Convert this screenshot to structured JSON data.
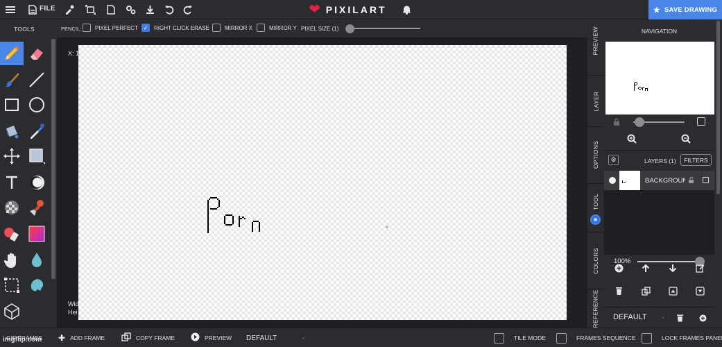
{
  "topbar": {
    "file_label": "FILE",
    "brand": "PIXILART",
    "save_label": "SAVE DRAWING"
  },
  "tools": {
    "title": "TOOLS",
    "items": [
      "pencil",
      "eraser",
      "brush",
      "line",
      "rectangle",
      "ellipse",
      "bucket",
      "eyedropper",
      "move",
      "selection-fill",
      "text",
      "dither",
      "pattern",
      "stamp",
      "shape-eraser",
      "gradient",
      "hand",
      "drop",
      "select",
      "smudge",
      "3d-cube"
    ],
    "active": "pencil"
  },
  "options": {
    "tool_label": "PENCIL:",
    "pixel_perfect": {
      "label": "PIXEL PERFECT",
      "checked": false
    },
    "right_click_erase": {
      "label": "RIGHT CLICK ERASE",
      "checked": true
    },
    "mirror_x": {
      "label": "MIRROR X",
      "checked": false
    },
    "mirror_y": {
      "label": "MIRROR Y",
      "checked": false
    },
    "pixel_size_label": "PIXEL SIZE (1)"
  },
  "workspace": {
    "coord_text": "X: 1",
    "dims_line1": "Wid",
    "dims_line2": "Hei"
  },
  "side_tabs": [
    "PREVIEW",
    "LAYER",
    "OPTIONS",
    "TOOL",
    "COLORS",
    "REFERENCE"
  ],
  "navigation": {
    "title": "NAVIGATION"
  },
  "layers": {
    "title": "LAYERS (1)",
    "filters_label": "FILTERS",
    "items": [
      {
        "name": "BACKGROUND"
      }
    ],
    "opacity_label": "100%",
    "opacity": 1.0
  },
  "palette": {
    "name": "DEFAULT"
  },
  "bottom": {
    "frames_label": "GIF FRAMES",
    "add_frame": "ADD FRAME",
    "copy_frame": "COPY FRAME",
    "preview": "PREVIEW",
    "frame_select": "DEFAULT",
    "tile_mode": "TILE MODE",
    "frames_sequence": "FRAMES SEQUENCE",
    "lock_frames_panel": "LOCK FRAMES PANEL"
  },
  "watermark": "imgflip.com",
  "colors": {
    "accent": "#4a86e8",
    "heart": "#e02045",
    "panel": "#2b2c30",
    "background": "#1e1f22"
  }
}
